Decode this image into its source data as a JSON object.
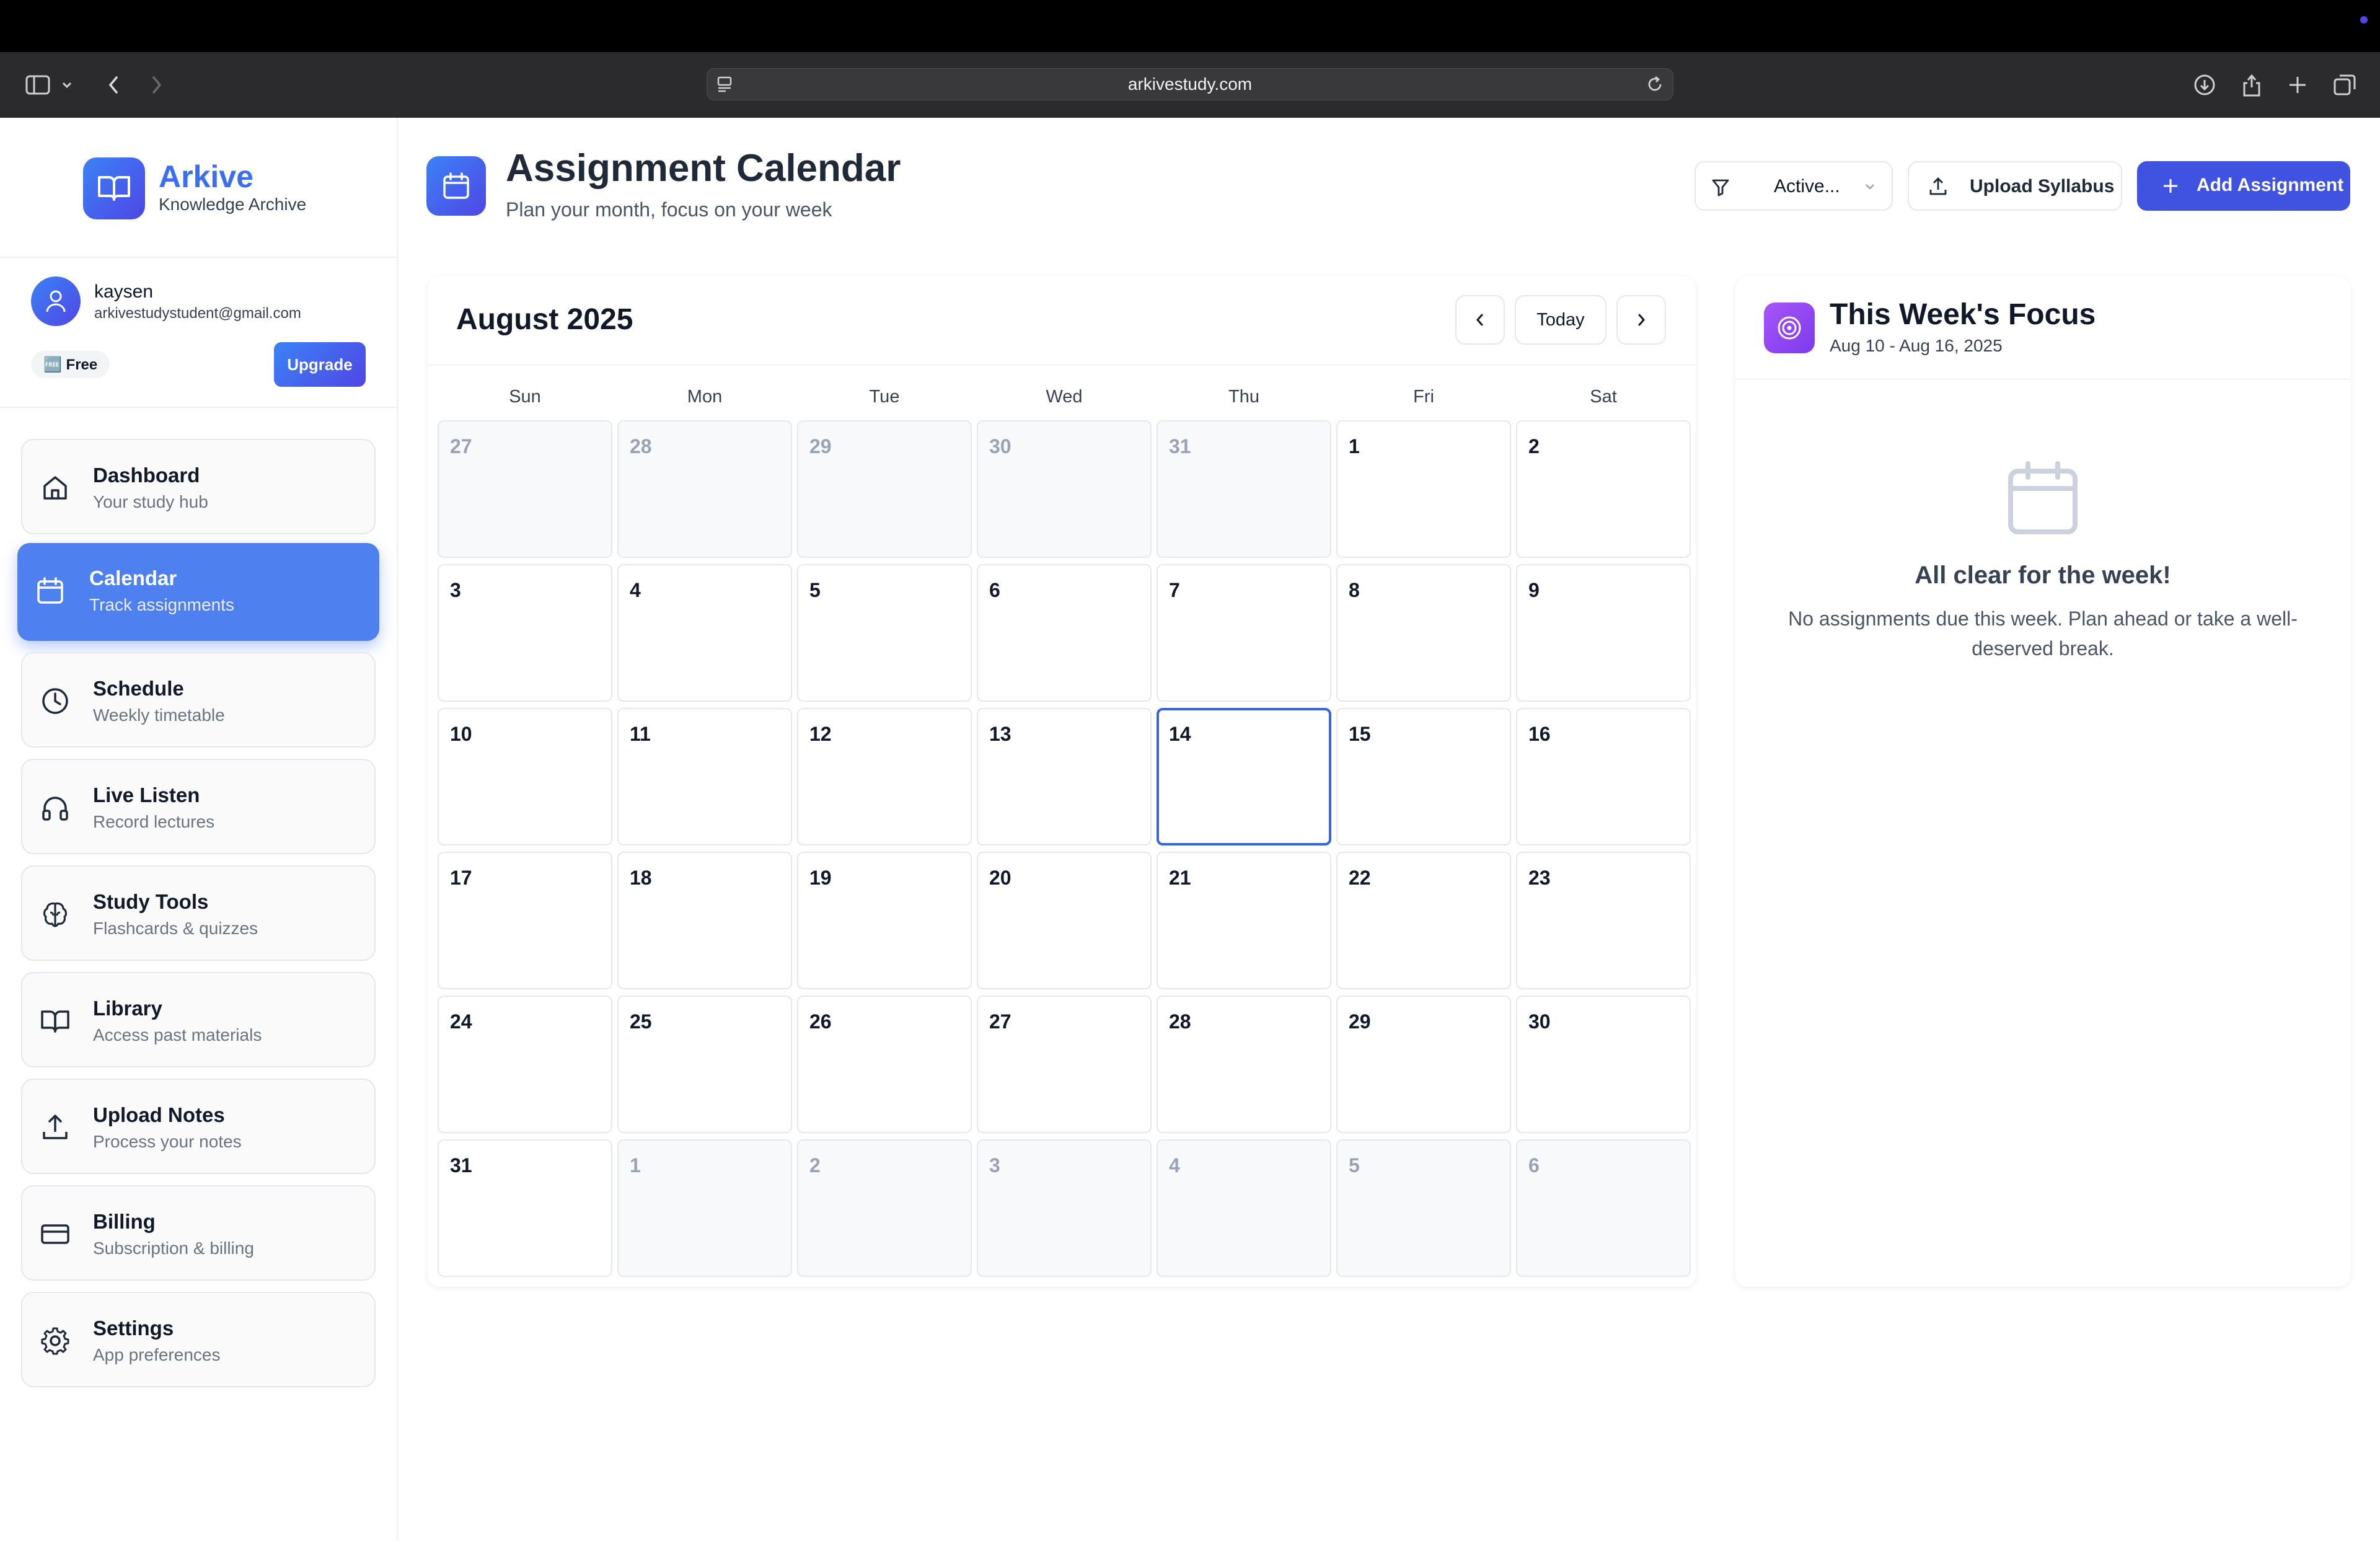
{
  "browser": {
    "url": "arkivestudy.com"
  },
  "sidebar": {
    "app_name": "Arkive",
    "app_subtitle": "Knowledge Archive",
    "user": {
      "name": "kaysen",
      "email": "arkivestudystudent@gmail.com",
      "plan": "🆓 Free",
      "upgrade_label": "Upgrade"
    },
    "items": [
      {
        "title": "Dashboard",
        "subtitle": "Your study hub",
        "icon": "home-icon"
      },
      {
        "title": "Calendar",
        "subtitle": "Track assignments",
        "icon": "calendar-icon"
      },
      {
        "title": "Schedule",
        "subtitle": "Weekly timetable",
        "icon": "clock-icon"
      },
      {
        "title": "Live Listen",
        "subtitle": "Record lectures",
        "icon": "headphones-icon"
      },
      {
        "title": "Study Tools",
        "subtitle": "Flashcards & quizzes",
        "icon": "brain-icon"
      },
      {
        "title": "Library",
        "subtitle": "Access past materials",
        "icon": "book-icon"
      },
      {
        "title": "Upload Notes",
        "subtitle": "Process your notes",
        "icon": "upload-icon"
      },
      {
        "title": "Billing",
        "subtitle": "Subscription & billing",
        "icon": "credit-card-icon"
      },
      {
        "title": "Settings",
        "subtitle": "App preferences",
        "icon": "gear-icon"
      }
    ]
  },
  "header": {
    "title": "Assignment Calendar",
    "subtitle": "Plan your month, focus on your week",
    "filter_value": "Active...",
    "upload_label": "Upload Syllabus",
    "add_label": "Add Assignment"
  },
  "calendar": {
    "month_label": "August 2025",
    "today_label": "Today",
    "weekdays": [
      "Sun",
      "Mon",
      "Tue",
      "Wed",
      "Thu",
      "Fri",
      "Sat"
    ],
    "weeks": [
      [
        {
          "d": "27",
          "other": true
        },
        {
          "d": "28",
          "other": true
        },
        {
          "d": "29",
          "other": true
        },
        {
          "d": "30",
          "other": true
        },
        {
          "d": "31",
          "other": true
        },
        {
          "d": "1"
        },
        {
          "d": "2"
        }
      ],
      [
        {
          "d": "3"
        },
        {
          "d": "4"
        },
        {
          "d": "5"
        },
        {
          "d": "6"
        },
        {
          "d": "7"
        },
        {
          "d": "8"
        },
        {
          "d": "9"
        }
      ],
      [
        {
          "d": "10"
        },
        {
          "d": "11"
        },
        {
          "d": "12"
        },
        {
          "d": "13"
        },
        {
          "d": "14",
          "today": true
        },
        {
          "d": "15"
        },
        {
          "d": "16"
        }
      ],
      [
        {
          "d": "17"
        },
        {
          "d": "18"
        },
        {
          "d": "19"
        },
        {
          "d": "20"
        },
        {
          "d": "21"
        },
        {
          "d": "22"
        },
        {
          "d": "23"
        }
      ],
      [
        {
          "d": "24"
        },
        {
          "d": "25"
        },
        {
          "d": "26"
        },
        {
          "d": "27"
        },
        {
          "d": "28"
        },
        {
          "d": "29"
        },
        {
          "d": "30"
        }
      ],
      [
        {
          "d": "31"
        },
        {
          "d": "1",
          "other": true
        },
        {
          "d": "2",
          "other": true
        },
        {
          "d": "3",
          "other": true
        },
        {
          "d": "4",
          "other": true
        },
        {
          "d": "5",
          "other": true
        },
        {
          "d": "6",
          "other": true
        }
      ]
    ]
  },
  "focus": {
    "title": "This Week's Focus",
    "range": "Aug 10 - Aug 16, 2025",
    "empty_title": "All clear for the week!",
    "empty_text": "No assignments due this week. Plan ahead or take a well-deserved break."
  },
  "colors": {
    "accent": "#4053e0",
    "active_nav": "#4f80f0",
    "today_border": "#3b63d9",
    "focus_accent": "#a855f7"
  }
}
